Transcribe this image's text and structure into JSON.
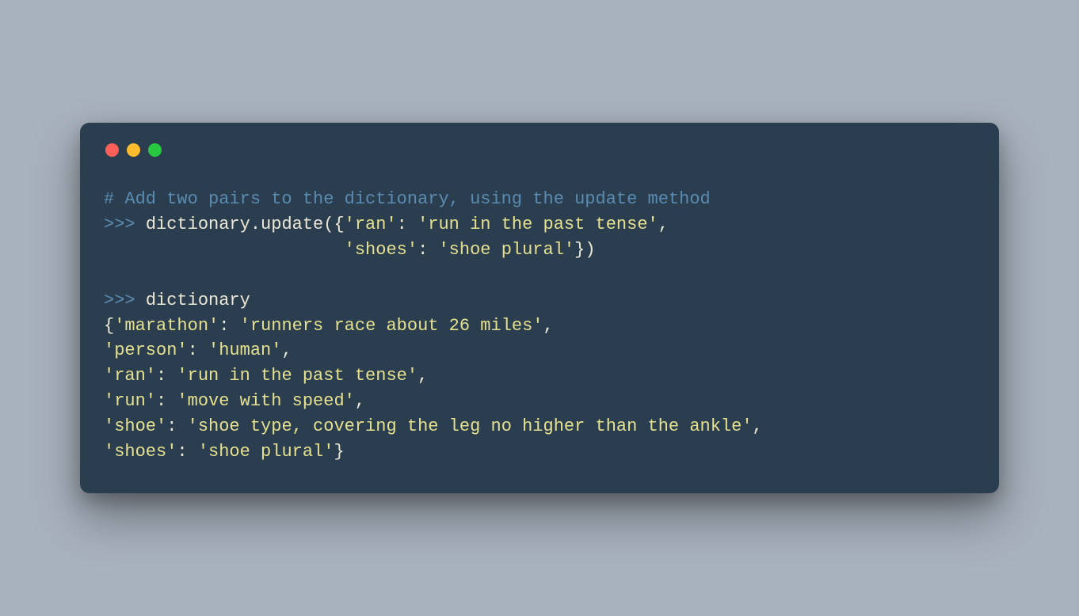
{
  "code": {
    "line1_comment": "# Add two pairs to the dictionary, using the update method",
    "line2_prompt": ">>> ",
    "line2_text1": "dictionary.update({",
    "line2_str1": "'ran'",
    "line2_text2": ": ",
    "line2_str2": "'run in the past tense'",
    "line2_text3": ",",
    "line3_pad": "                       ",
    "line3_str1": "'shoes'",
    "line3_text1": ": ",
    "line3_str2": "'shoe plural'",
    "line3_text2": "})",
    "blank": "",
    "line5_prompt": ">>> ",
    "line5_text": "dictionary",
    "line6_text1": "{",
    "line6_str1": "'marathon'",
    "line6_text2": ": ",
    "line6_str2": "'runners race about 26 miles'",
    "line6_text3": ",",
    "line7_str1": "'person'",
    "line7_text1": ": ",
    "line7_str2": "'human'",
    "line7_text2": ",",
    "line8_str1": "'ran'",
    "line8_text1": ": ",
    "line8_str2": "'run in the past tense'",
    "line8_text2": ",",
    "line9_str1": "'run'",
    "line9_text1": ": ",
    "line9_str2": "'move with speed'",
    "line9_text2": ",",
    "line10_str1": "'shoe'",
    "line10_text1": ": ",
    "line10_str2": "'shoe type, covering the leg no higher than the ankle'",
    "line10_text2": ",",
    "line11_str1": "'shoes'",
    "line11_text1": ": ",
    "line11_str2": "'shoe plural'",
    "line11_text2": "}"
  }
}
